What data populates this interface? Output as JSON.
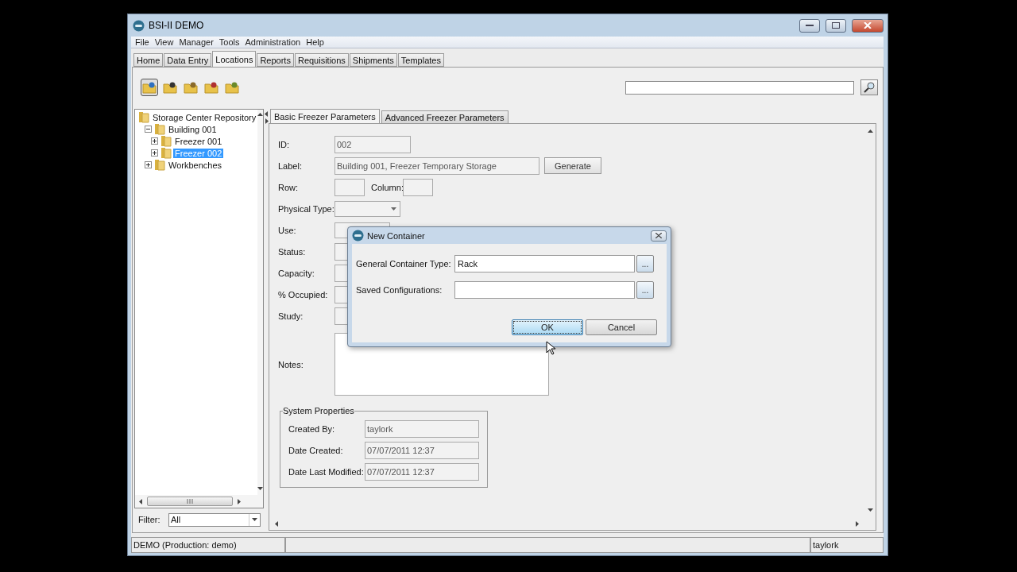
{
  "window": {
    "title": "BSI-II DEMO"
  },
  "menu": [
    "File",
    "View",
    "Manager",
    "Tools",
    "Administration",
    "Help"
  ],
  "tabs": [
    {
      "label": "Home",
      "selected": false
    },
    {
      "label": "Data Entry",
      "selected": false
    },
    {
      "label": "Locations",
      "selected": true
    },
    {
      "label": "Reports",
      "selected": false
    },
    {
      "label": "Requisitions",
      "selected": false
    },
    {
      "label": "Shipments",
      "selected": false
    },
    {
      "label": "Templates",
      "selected": false
    }
  ],
  "tree": {
    "items": [
      {
        "label": "Storage Center Repository",
        "selected": false,
        "children": [
          {
            "label": "Building 001",
            "expanded": true,
            "selected": false,
            "children": [
              {
                "label": "Freezer 001",
                "expanded": false,
                "selected": false
              },
              {
                "label": "Freezer 002",
                "expanded": false,
                "selected": true
              }
            ]
          },
          {
            "label": "Workbenches",
            "expanded": false,
            "selected": false
          }
        ]
      }
    ]
  },
  "filter": {
    "label": "Filter:",
    "value": "All"
  },
  "detail_tabs": [
    {
      "label": "Basic Freezer Parameters",
      "selected": true
    },
    {
      "label": "Advanced Freezer Parameters",
      "selected": false
    }
  ],
  "form": [
    {
      "kind": "text",
      "label": "ID:",
      "value": "002"
    },
    {
      "kind": "text",
      "label": "Label:",
      "value": "Building 001, Freezer Temporary Storage",
      "button": "Generate"
    },
    {
      "kind": "pair",
      "label": "Row:",
      "second_label": "Column:"
    },
    {
      "kind": "dropdown",
      "label": "Physical Type:"
    },
    {
      "kind": "dropdown",
      "label": "Use:"
    },
    {
      "kind": "text",
      "label": "Status:"
    },
    {
      "kind": "text",
      "label": "Capacity:"
    },
    {
      "kind": "text",
      "label": "% Occupied:"
    },
    {
      "kind": "text",
      "label": "Study:"
    },
    {
      "kind": "textarea",
      "label": "Notes:"
    }
  ],
  "system_properties": {
    "title": "System Properties",
    "rows": [
      {
        "label": "Created By:",
        "value": "taylork"
      },
      {
        "label": "Date Created:",
        "value": "07/07/2011 12:37"
      },
      {
        "label": "Date Last Modified:",
        "value": "07/07/2011 12:37"
      }
    ]
  },
  "dialog": {
    "title": "New Container",
    "fields": [
      {
        "label": "General Container Type:",
        "value": "Rack",
        "button": "..."
      },
      {
        "label": "Saved Configurations:",
        "button": "..."
      }
    ],
    "buttons": [
      {
        "label": "OK",
        "default": true
      },
      {
        "label": "Cancel",
        "default": false
      }
    ]
  },
  "status_bar": {
    "left": "DEMO (Production: demo)",
    "right": "taylork"
  }
}
